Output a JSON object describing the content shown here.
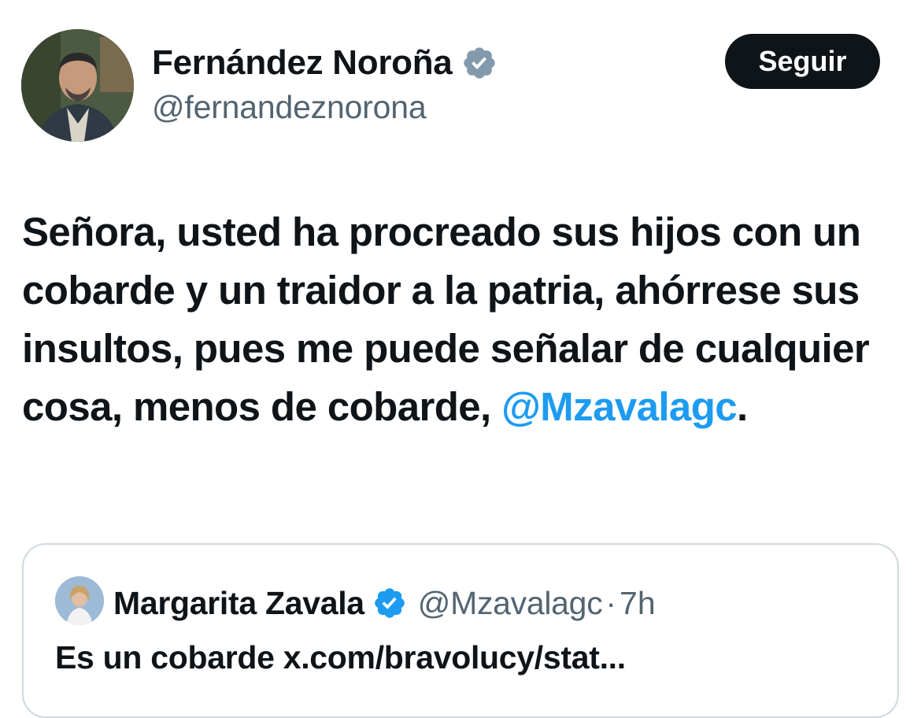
{
  "author": {
    "display_name": "Fernández Noroña",
    "handle": "@fernandeznorona",
    "verified_badge_color": "#829aab"
  },
  "follow_button": {
    "label": "Seguir",
    "bg": "#0f1419"
  },
  "tweet": {
    "text_before_mention": "Señora, usted ha procreado sus hijos con un cobarde y un traidor a la patria, ahórrese sus insultos, pues me puede señalar de cualquier cosa, menos de cobarde, ",
    "mention": "@Mzavalagc",
    "text_after_mention": "."
  },
  "quoted_tweet": {
    "display_name": "Margarita Zavala",
    "handle": "@Mzavalagc",
    "separator": "·",
    "time": "7h",
    "text": "Es un cobarde x.com/bravolucy/stat...",
    "verified_badge_color": "#1d9bf0"
  },
  "colors": {
    "text_primary": "#0f1419",
    "text_secondary": "#536471",
    "link": "#1d9bf0",
    "border": "#cfd9de"
  }
}
